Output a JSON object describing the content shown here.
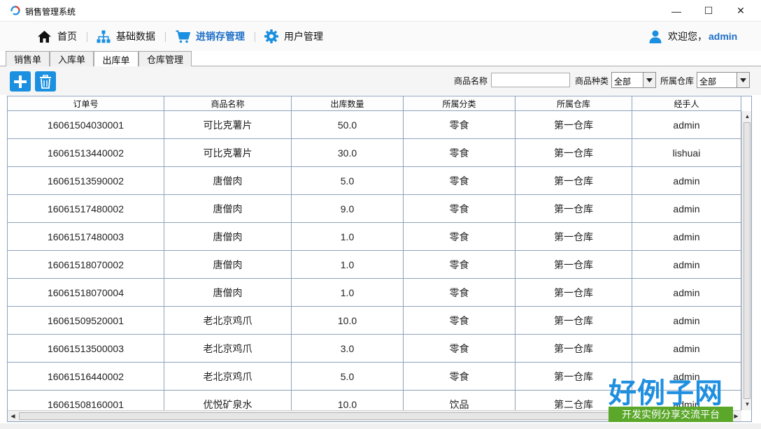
{
  "window": {
    "title": "销售管理系统",
    "min_glyph": "—",
    "max_glyph": "☐",
    "close_glyph": "✕"
  },
  "menu": {
    "items": [
      {
        "label": "首页",
        "icon": "home-icon"
      },
      {
        "label": "基础数据",
        "icon": "hierarchy-icon"
      },
      {
        "label": "进销存管理",
        "icon": "cart-icon",
        "active": true
      },
      {
        "label": "用户管理",
        "icon": "gear-icon"
      }
    ],
    "welcome_prefix": "欢迎您，",
    "welcome_user": "admin"
  },
  "tabs": [
    "销售单",
    "入库单",
    "出库单",
    "仓库管理"
  ],
  "active_tab": "出库单",
  "toolbar": {
    "add_icon": "plus-icon",
    "delete_icon": "trash-icon",
    "product_name_label": "商品名称",
    "product_name_value": "",
    "category_label": "商品种类",
    "category_value": "全部",
    "warehouse_label": "所属仓库",
    "warehouse_value": "全部"
  },
  "table": {
    "columns": [
      "订单号",
      "商品名称",
      "出库数量",
      "所属分类",
      "所属仓库",
      "经手人"
    ],
    "rows": [
      [
        "16061504030001",
        "可比克薯片",
        "50.0",
        "零食",
        "第一仓库",
        "admin"
      ],
      [
        "16061513440002",
        "可比克薯片",
        "30.0",
        "零食",
        "第一仓库",
        "lishuai"
      ],
      [
        "16061513590002",
        "唐僧肉",
        "5.0",
        "零食",
        "第一仓库",
        "admin"
      ],
      [
        "16061517480002",
        "唐僧肉",
        "9.0",
        "零食",
        "第一仓库",
        "admin"
      ],
      [
        "16061517480003",
        "唐僧肉",
        "1.0",
        "零食",
        "第一仓库",
        "admin"
      ],
      [
        "16061518070002",
        "唐僧肉",
        "1.0",
        "零食",
        "第一仓库",
        "admin"
      ],
      [
        "16061518070004",
        "唐僧肉",
        "1.0",
        "零食",
        "第一仓库",
        "admin"
      ],
      [
        "16061509520001",
        "老北京鸡爪",
        "10.0",
        "零食",
        "第一仓库",
        "admin"
      ],
      [
        "16061513500003",
        "老北京鸡爪",
        "3.0",
        "零食",
        "第一仓库",
        "admin"
      ],
      [
        "16061516440002",
        "老北京鸡爪",
        "5.0",
        "零食",
        "第一仓库",
        "admin"
      ],
      [
        "16061508160001",
        "优悦矿泉水",
        "10.0",
        "饮品",
        "第二仓库",
        "admin"
      ]
    ]
  },
  "watermark": {
    "logo_big": "好例子网",
    "logo_small": "开发实例分享交流平台"
  },
  "colors": {
    "accent": "#1e6fc8",
    "button_blue": "#1b8fe0",
    "grid_line": "#8ea2bd",
    "logo_green": "#5aa72a"
  }
}
